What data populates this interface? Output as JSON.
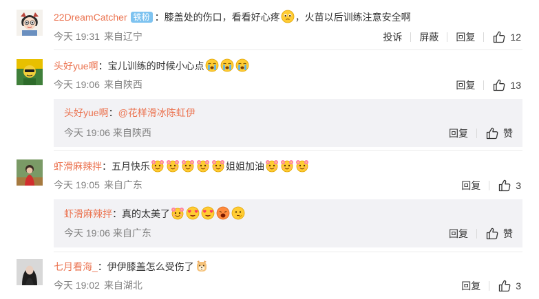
{
  "comments": [
    {
      "user": "22DreamCatcher",
      "badge": "铁粉",
      "text_a": "膝盖处的伤口，看看好心疼",
      "text_b": "，火苗以后训练注意安全啊",
      "time": "今天 19:31",
      "location": "来自辽宁",
      "report": "投诉",
      "block": "屏蔽",
      "reply": "回复",
      "likes": "12"
    },
    {
      "user": "头好yue啊",
      "text": "宝儿训练的时候小心点",
      "time": "今天 19:06",
      "location": "来自陕西",
      "reply": "回复",
      "likes": "13",
      "sub_reply": {
        "user": "头好yue啊",
        "mention": "@花样滑冰陈虹伊",
        "time": "今天 19:06",
        "location": "来自陕西",
        "reply": "回复",
        "likes": "赞"
      }
    },
    {
      "user": "虾滑麻辣拌",
      "text_a": "五月快乐",
      "text_b": "姐姐加油",
      "time": "今天 19:05",
      "location": "来自广东",
      "reply": "回复",
      "likes": "3",
      "sub_reply": {
        "user": "虾滑麻辣拌",
        "text": "真的太美了",
        "time": "今天 19:06",
        "location": "来自广东",
        "reply": "回复",
        "likes": "赞"
      }
    },
    {
      "user": "七月看海_",
      "text": "伊伊膝盖怎么受伤了",
      "time": "今天 19:02",
      "location": "来自湖北",
      "reply": "回复",
      "likes": "3"
    }
  ],
  "colors": {
    "username": "#eb7350",
    "badge": "#7ec3f0",
    "meta": "#808080",
    "reply_bg": "#f2f2f5"
  }
}
